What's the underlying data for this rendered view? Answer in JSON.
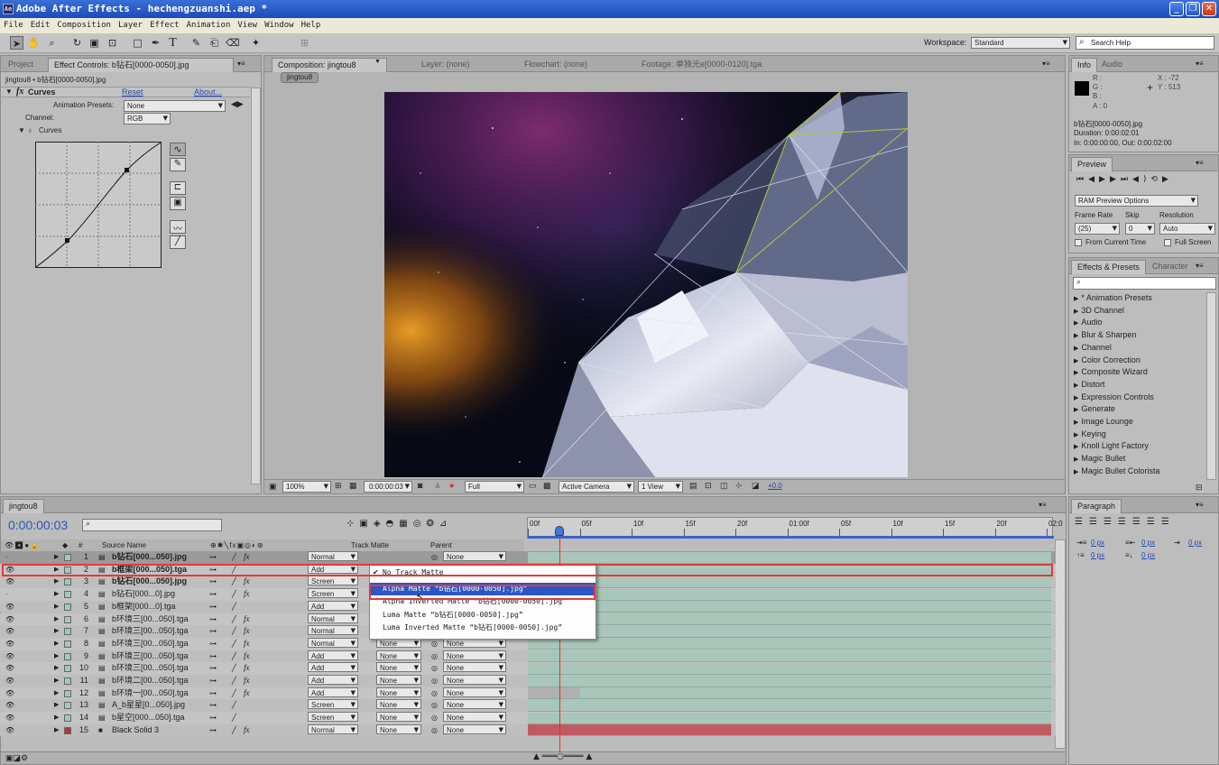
{
  "window": {
    "title": "Adobe After Effects - hechengzuanshi.aep *",
    "min": "_",
    "restore": "❐",
    "close": "✕"
  },
  "menu": [
    "File",
    "Edit",
    "Composition",
    "Layer",
    "Effect",
    "Animation",
    "View",
    "Window",
    "Help"
  ],
  "toolbar": {
    "workspace_label": "Workspace:",
    "workspace_value": "Standard",
    "search_placeholder": "Search Help"
  },
  "left_panel": {
    "tab_project": "Project",
    "tab_effect": "Effect Controls: b钻石[0000-0050].jpg",
    "breadcrumb": "jingtou8 • b钻石[0000-0050].jpg",
    "fx_name": "Curves",
    "reset": "Reset",
    "about": "About...",
    "anim_presets_label": "Animation Presets:",
    "anim_presets_value": "None",
    "channel_label": "Channel:",
    "channel_value": "RGB",
    "curves_label": "Curves"
  },
  "comp_panel": {
    "tab_comp": "Composition: jingtou8",
    "tab_layer": "Layer: (none)",
    "tab_flowchart": "Flowchart: (none)",
    "tab_footage": "Footage: 单独光e[0000-0120].tga",
    "comp_chip": "jingtou8",
    "zoom": "100%",
    "timecode": "0:00:00:03",
    "resolution": "Full",
    "camera": "Active Camera",
    "view": "1 View",
    "exposure": "+0.0"
  },
  "info_panel": {
    "tab_info": "Info",
    "tab_audio": "Audio",
    "r": "R :",
    "g": "G :",
    "b": "B :",
    "a": "A : 0",
    "x": "X : -72",
    "y": "Y : 513",
    "name": "b钻石[0000-0050].jpg",
    "duration": "Duration: 0:00:02:01",
    "inout": "In: 0:00:00:00, Out: 0:00:02:00"
  },
  "preview_panel": {
    "tab": "Preview",
    "ram": "RAM Preview Options",
    "frame_rate_label": "Frame Rate",
    "skip_label": "Skip",
    "resolution_label": "Resolution",
    "frame_rate": "(25)",
    "skip": "0",
    "resolution": "Auto",
    "from_current": "From Current Time",
    "full_screen": "Full Screen"
  },
  "effects_panel": {
    "tab": "Effects & Presets",
    "tab2": "Character",
    "items": [
      "* Animation Presets",
      "3D Channel",
      "Audio",
      "Blur & Sharpen",
      "Channel",
      "Color Correction",
      "Composite Wizard",
      "Distort",
      "Expression Controls",
      "Generate",
      "Image Lounge",
      "Keying",
      "Knoll Light Factory",
      "Magic Bullet",
      "Magic Bullet Colorista"
    ]
  },
  "paragraph_panel": {
    "tab": "Paragraph",
    "v1": "0 px",
    "v2": "0 px",
    "v3": "0 px",
    "v4": "0 px",
    "v5": "0 px"
  },
  "timeline": {
    "tab": "jingtou8",
    "timecode": "0:00:00:03",
    "col_source": "Source Name",
    "col_track": "Track Matte",
    "col_parent": "Parent",
    "ruler": [
      "00f",
      "05f",
      "10f",
      "15f",
      "20f",
      "01:00f",
      "05f",
      "10f",
      "15f",
      "20f",
      "02:0"
    ],
    "layers": [
      {
        "num": "1",
        "name": "b钻石[000...050].jpg",
        "mode": "Normal",
        "track": "",
        "parent": "None"
      },
      {
        "num": "2",
        "name": "b框架[000...050].tga",
        "mode": "Add",
        "track": "",
        "parent": ""
      },
      {
        "num": "3",
        "name": "b钻石[000...050].jpg",
        "mode": "Screen",
        "track": "",
        "parent": ""
      },
      {
        "num": "4",
        "name": "b钻石[000...0].jpg",
        "mode": "Screen",
        "track": "",
        "parent": ""
      },
      {
        "num": "5",
        "name": "b框架[000...0].tga",
        "mode": "Add",
        "track": "",
        "parent": ""
      },
      {
        "num": "6",
        "name": "b环境三[00...050].tga",
        "mode": "Normal",
        "track": "",
        "parent": ""
      },
      {
        "num": "7",
        "name": "b环境三[00...050].tga",
        "mode": "Normal",
        "track": "",
        "parent": ""
      },
      {
        "num": "8",
        "name": "b环境三[00...050].tga",
        "mode": "Normal",
        "track": "None",
        "parent": "None"
      },
      {
        "num": "9",
        "name": "b环境三[00...050].tga",
        "mode": "Add",
        "track": "None",
        "parent": "None"
      },
      {
        "num": "10",
        "name": "b环境三[00...050].tga",
        "mode": "Add",
        "track": "None",
        "parent": "None"
      },
      {
        "num": "11",
        "name": "b环境二[00...050].tga",
        "mode": "Add",
        "track": "None",
        "parent": "None"
      },
      {
        "num": "12",
        "name": "b环境一[00...050].tga",
        "mode": "Add",
        "track": "None",
        "parent": "None"
      },
      {
        "num": "13",
        "name": "A_b星星[0...050].jpg",
        "mode": "Screen",
        "track": "None",
        "parent": "None"
      },
      {
        "num": "14",
        "name": "b星空[000...050].tga",
        "mode": "Screen",
        "track": "None",
        "parent": "None"
      },
      {
        "num": "15",
        "name": "Black Solid 3",
        "mode": "Normal",
        "track": "None",
        "parent": "None"
      }
    ],
    "matte_menu": [
      {
        "label": "No Track Matte",
        "checked": true
      },
      {
        "label": "Alpha Matte “b钻石[0000-0050].jpg”",
        "checked": false
      },
      {
        "label": "Alpha Inverted Matte “b钻石[0000-0050].jpg”",
        "checked": false
      },
      {
        "label": "Luma Matte “b钻石[0000-0050].jpg”",
        "checked": false
      },
      {
        "label": "Luma Inverted Matte “b钻石[0000-0050].jpg”",
        "checked": false
      }
    ]
  },
  "colors": {
    "highlight": "#e23a3a",
    "selection": "#2b56c6",
    "track": "#a8c6b9",
    "solid_track": "#c25a62",
    "playhead": "#e03030",
    "timecode": "#2a55c0"
  }
}
